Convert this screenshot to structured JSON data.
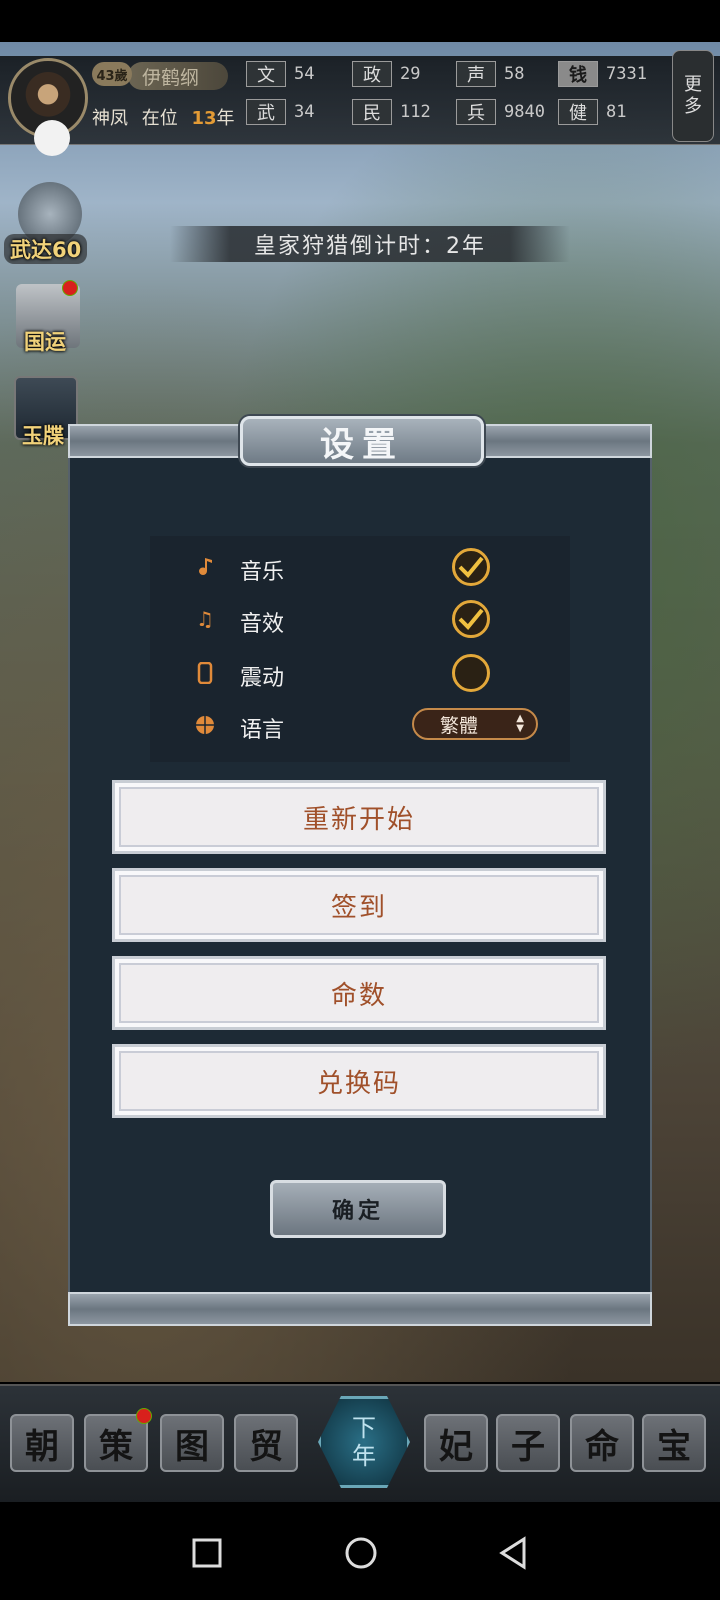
{
  "hud": {
    "age": "43歲",
    "ruler_name": "伊鹤纲",
    "era_name": "神凤",
    "era_label": "在位",
    "reign_years": "13",
    "reign_unit": "年",
    "stats": [
      {
        "tag": "文",
        "value": "54"
      },
      {
        "tag": "政",
        "value": "29"
      },
      {
        "tag": "声",
        "value": "58"
      },
      {
        "tag": "钱",
        "value": "7331"
      },
      {
        "tag": "武",
        "value": "34"
      },
      {
        "tag": "民",
        "value": "112"
      },
      {
        "tag": "兵",
        "value": "9840"
      },
      {
        "tag": "健",
        "value": "81"
      }
    ],
    "more_label_1": "更",
    "more_label_2": "多"
  },
  "side": {
    "wuda_label": "武达60",
    "guoyun_label": "国运",
    "yuxi_label": "玉牒"
  },
  "hunt_banner": "皇家狩猎倒计时：2年",
  "dialog": {
    "title": "设置",
    "options": [
      {
        "icon": "music-icon",
        "label": "音乐",
        "checked": true
      },
      {
        "icon": "sound-note-icon",
        "label": "音效",
        "checked": true
      },
      {
        "icon": "phone-vibrate-icon",
        "label": "震动",
        "checked": false
      },
      {
        "icon": "globe-icon",
        "label": "语言",
        "checked": null
      }
    ],
    "language_value": "繁體",
    "buttons": [
      "重新开始",
      "签到",
      "命数",
      "兑换码"
    ],
    "confirm": "确定"
  },
  "bottom_nav": {
    "left": [
      "朝",
      "策",
      "图",
      "贸"
    ],
    "center_top": "下",
    "center_bottom": "年",
    "right": [
      "妃",
      "子",
      "命",
      "宝"
    ]
  },
  "colors": {
    "accent_orange": "#e3a83a",
    "dialog_bg": "#1d2a35",
    "button_text": "#a0502a"
  }
}
